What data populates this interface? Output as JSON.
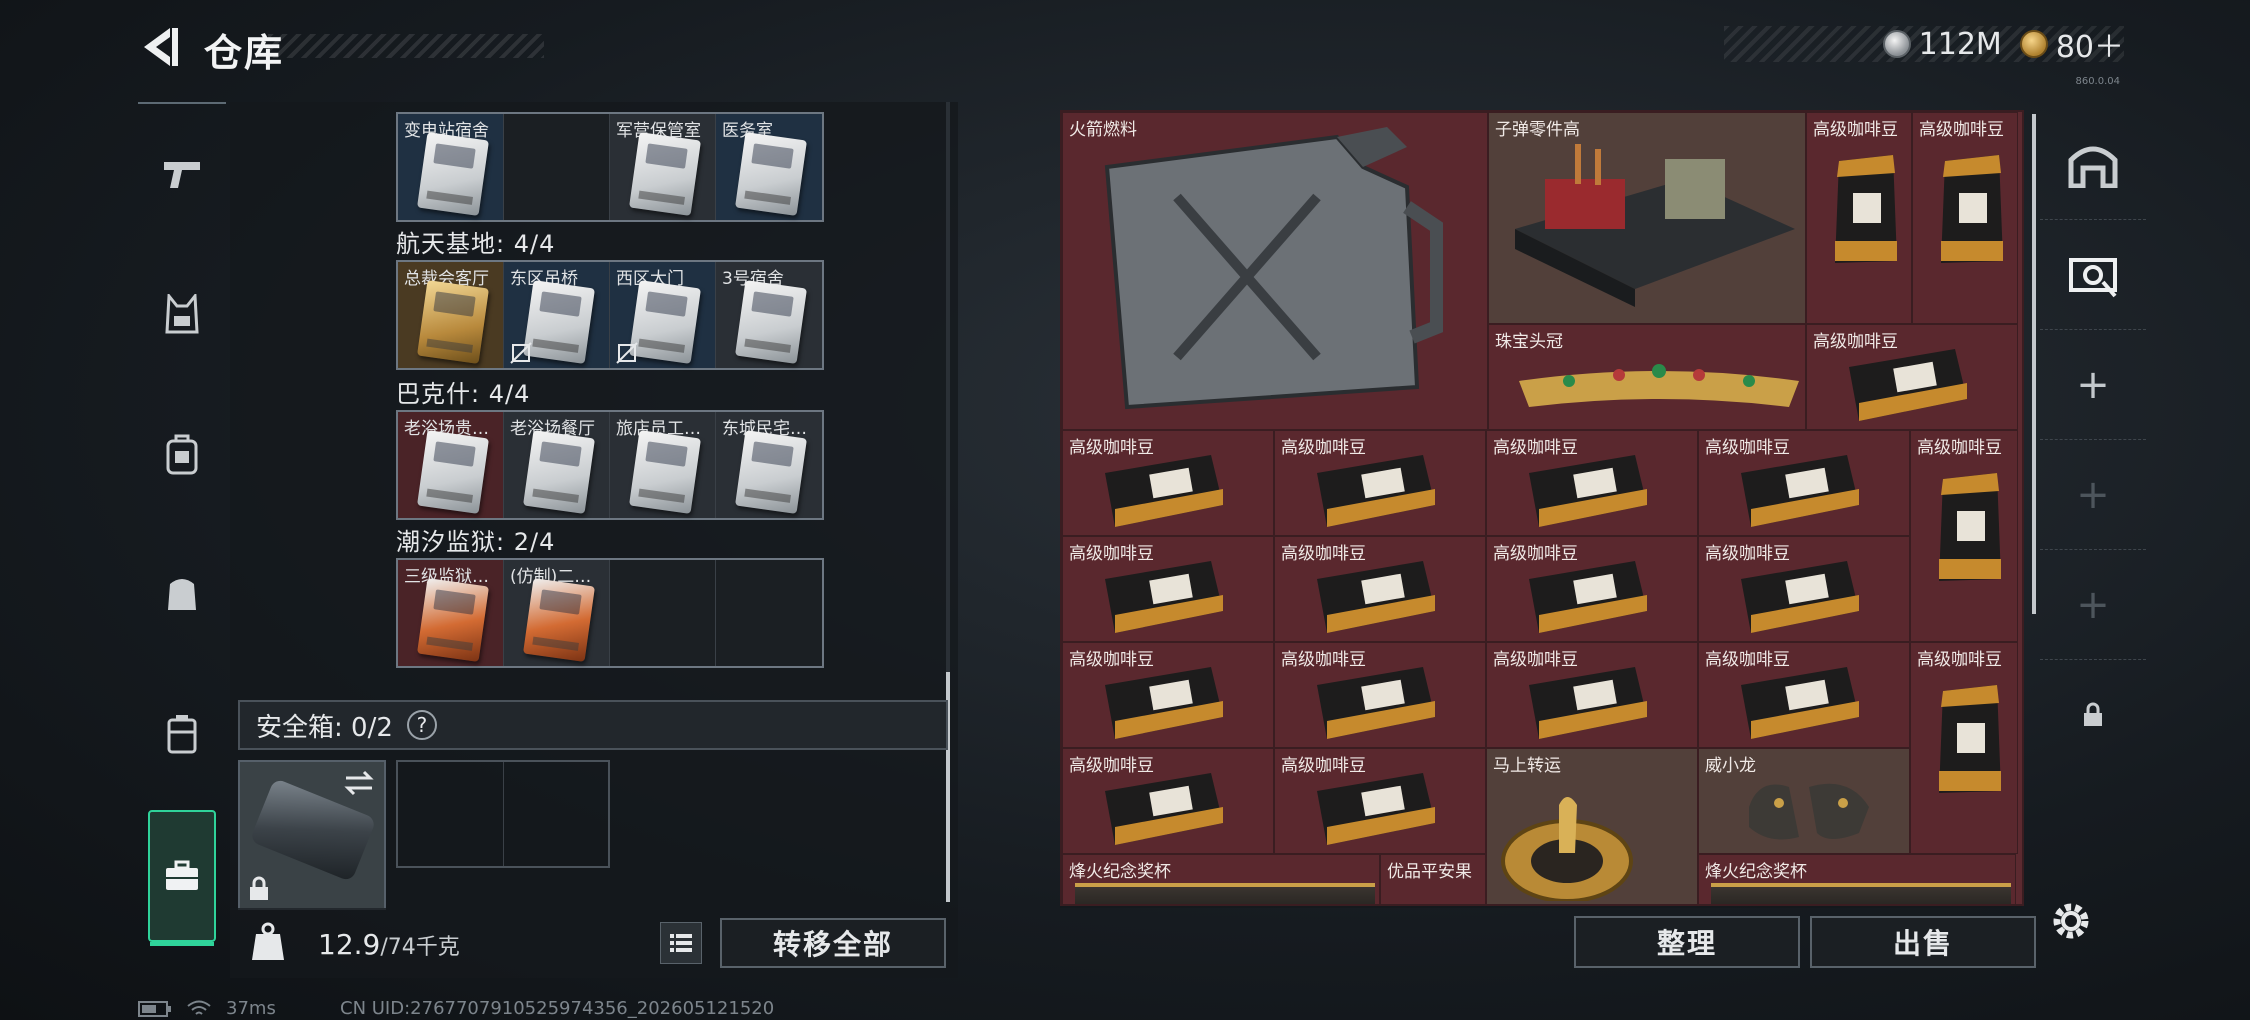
{
  "header": {
    "title": "仓库",
    "currency_silver": "112M",
    "currency_gold": "80＋",
    "version": "860.0.04"
  },
  "left_rail": [
    "weapon-icon",
    "armor-icon",
    "backpack-icon",
    "chest-rig-icon",
    "container-icon",
    "briefcase-icon"
  ],
  "keys": {
    "row0": [
      "变电站宿舍",
      "",
      "军营保管室",
      "医务室"
    ],
    "section1": "航天基地: 4/4",
    "row1": [
      "总裁会客厅",
      "东区吊桥",
      "西区大门",
      "3号宿舍"
    ],
    "section2": "巴克什: 4/4",
    "row2": [
      "老浴场贵…",
      "老浴场餐厅",
      "旅店员工…",
      "东城民宅…"
    ],
    "section3": "潮汐监狱: 2/4",
    "row3": [
      "三级监狱…",
      "(仿制)二…",
      "",
      ""
    ]
  },
  "safebox": {
    "label": "安全箱: 0/2",
    "help": "?"
  },
  "inventory_footer": {
    "weight": "12.9",
    "capacity": "/74千克",
    "transfer_all": "转移全部"
  },
  "stash": {
    "items": {
      "rocket_fuel": "火箭燃料",
      "ammo_parts": "子弹零件高",
      "coffee": "高级咖啡豆",
      "crown": "珠宝头冠",
      "fortune": "马上转运",
      "weixiaolong": "威小龙",
      "beacon_trophy": "烽火纪念奖杯",
      "apple": "优品平安果"
    },
    "sort": "整理",
    "sell": "出售"
  },
  "status": {
    "ping": "37ms",
    "uid": "CN UID:2767707910525974356_202605121520"
  }
}
